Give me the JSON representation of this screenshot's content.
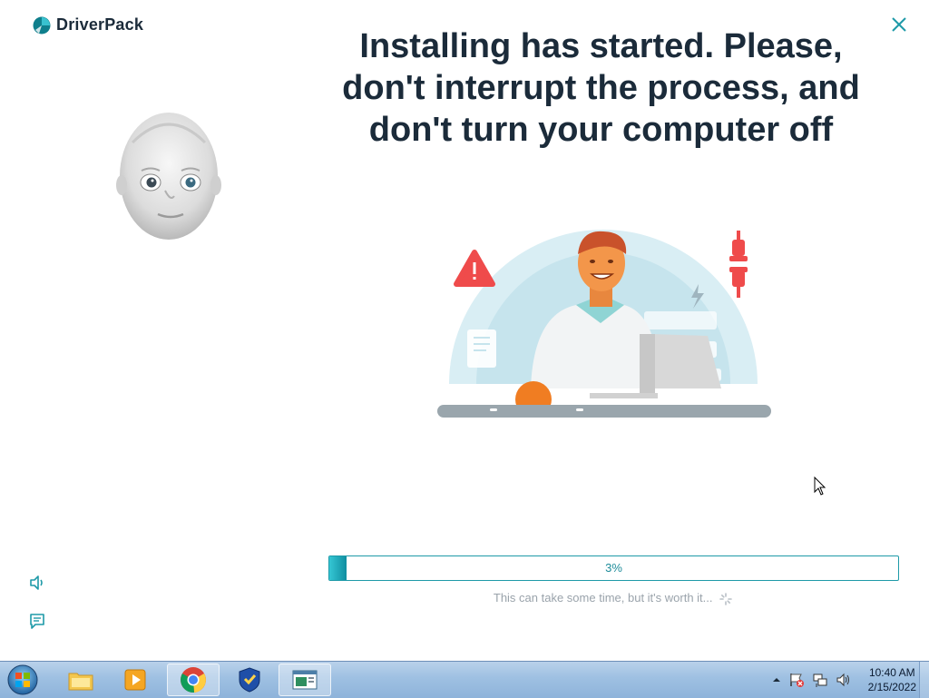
{
  "app": {
    "name": "DriverPack",
    "close_icon": "close-icon"
  },
  "headline": {
    "lines": [
      "Installing has started. Please,",
      "don't interrupt the process, and",
      "don't turn your computer off"
    ]
  },
  "progress": {
    "value": 3,
    "label": "3%",
    "fraction": 0.03
  },
  "hint": "This can take some time, but it's worth it...",
  "sidebar": {
    "sound_icon": "speaker-icon",
    "chat_icon": "chat-icon"
  },
  "taskbar": {
    "start_icon": "windows-start-icon",
    "pinned": [
      "file-explorer-icon",
      "media-player-icon",
      "chrome-icon",
      "driverpack-shield-icon",
      "app-window-icon"
    ],
    "tray_icons": [
      "show-hidden-icons-arrow",
      "action-center-flag-icon",
      "network-icon",
      "volume-icon"
    ],
    "time": "10:40 AM",
    "date": "2/15/2022"
  },
  "colors": {
    "accent": "#1e9aa8",
    "headline": "#1b2b3a",
    "hint": "#9aa3ab"
  }
}
